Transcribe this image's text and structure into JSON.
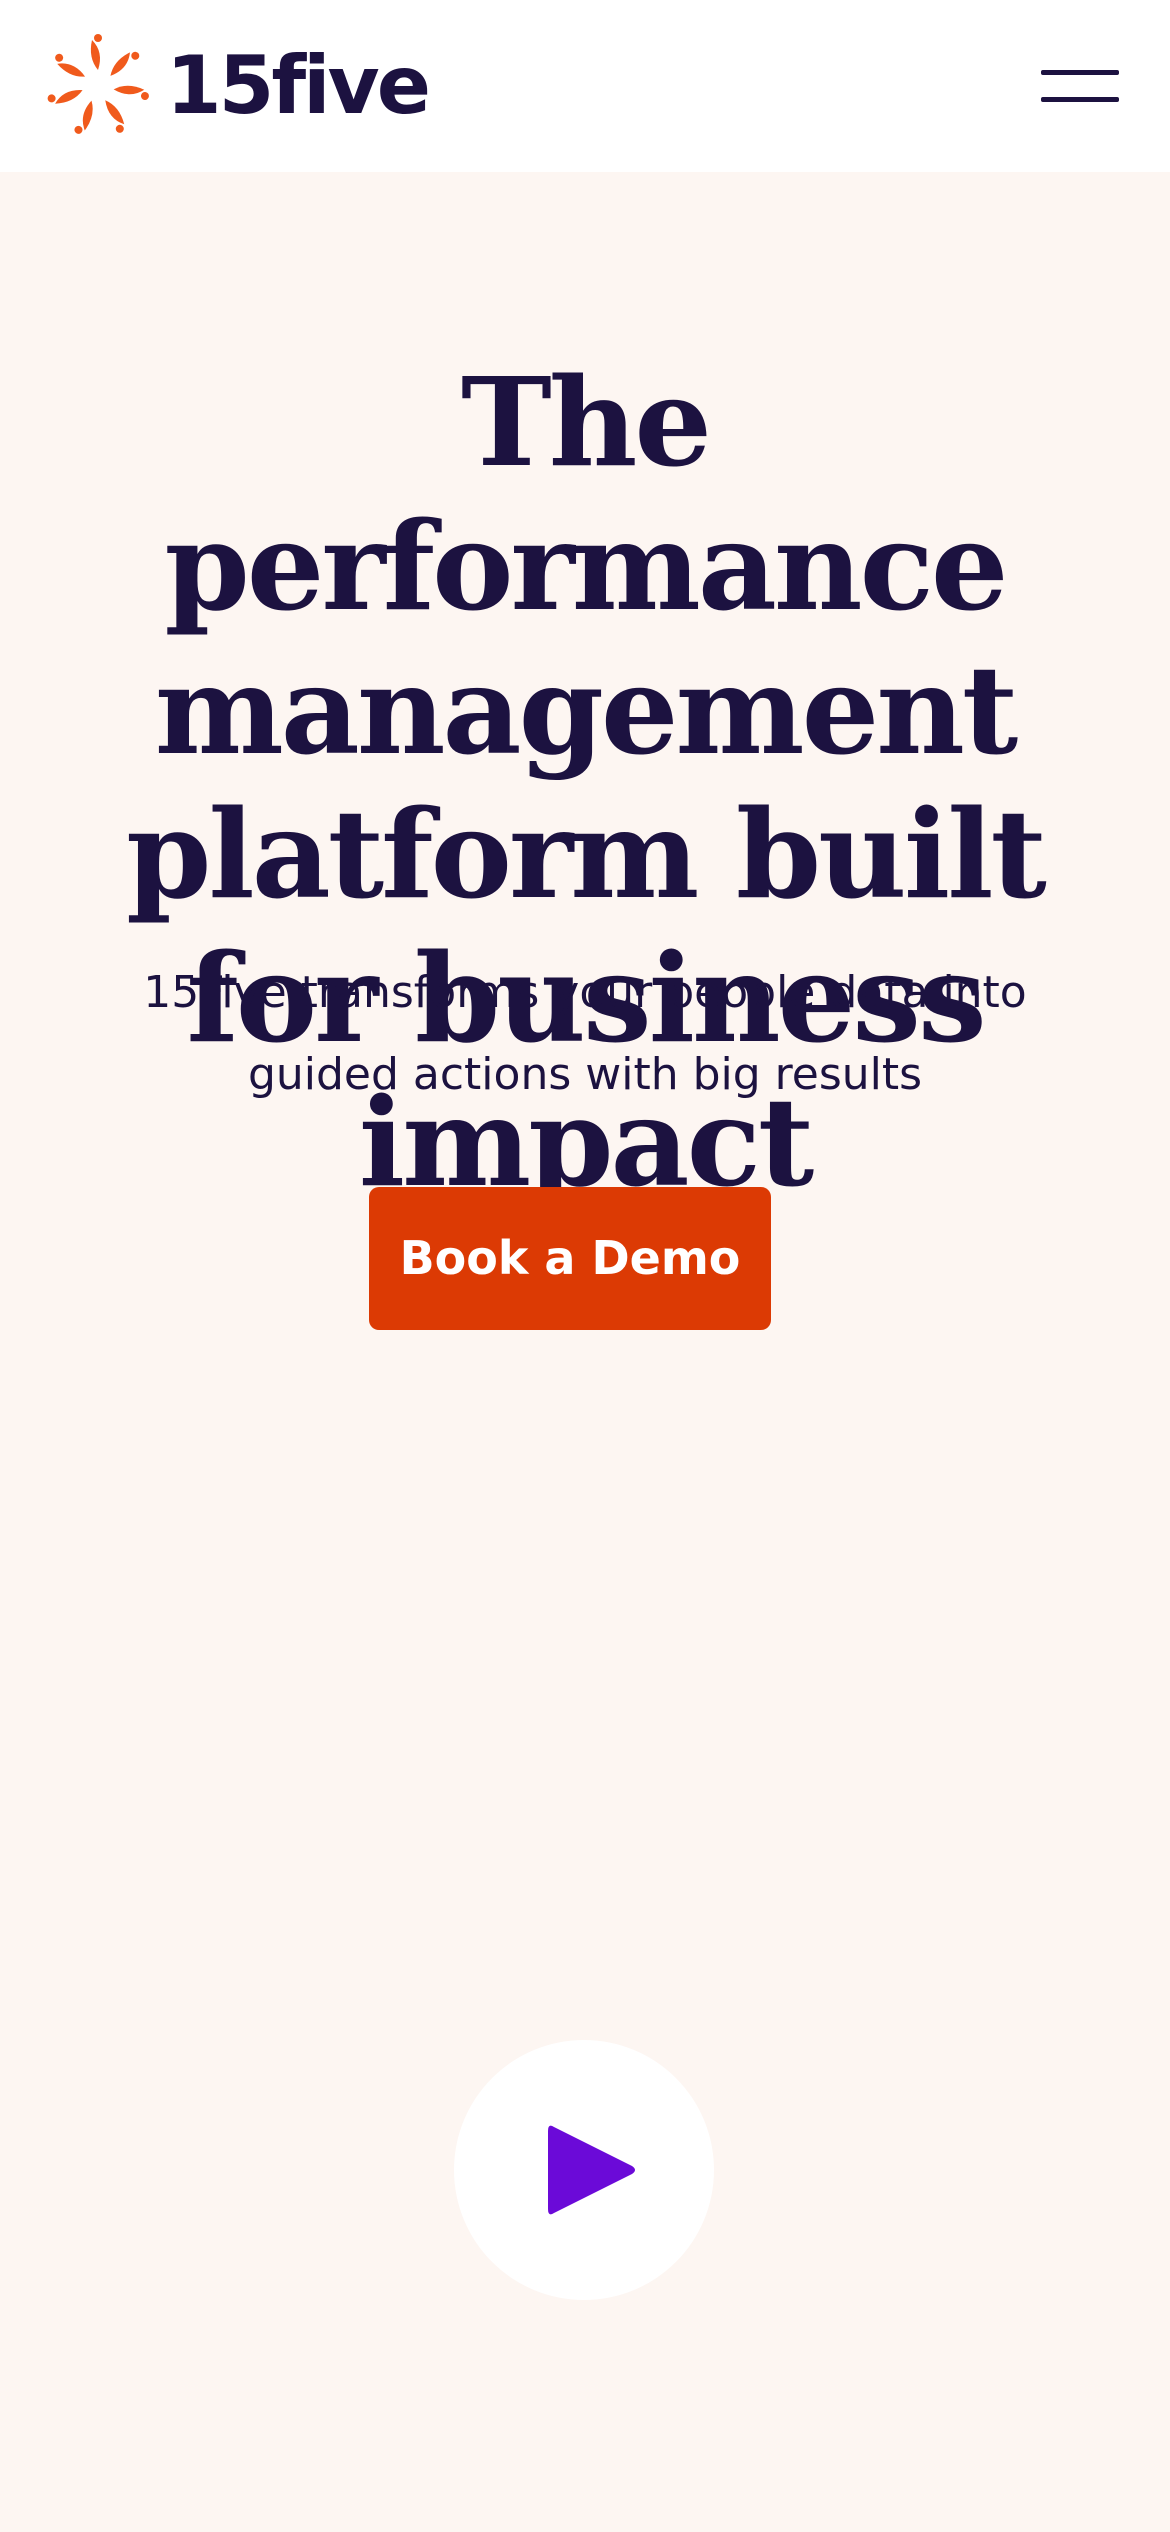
{
  "header": {
    "logo_text": "15five",
    "logo_icon": "sunburst-logo-icon",
    "menu_icon": "hamburger-menu-icon"
  },
  "hero": {
    "title": "The performance management platform built for business impact",
    "subtitle": "15Five transforms your people data into guided actions with big results",
    "cta_label": "Book a Demo",
    "play_icon": "play-icon"
  },
  "colors": {
    "brand_orange": "#f05a1c",
    "navy": "#1c1240",
    "cta_background": "#dc3a04",
    "page_background": "#fdf6f2",
    "play_purple": "#6b0ad8"
  }
}
